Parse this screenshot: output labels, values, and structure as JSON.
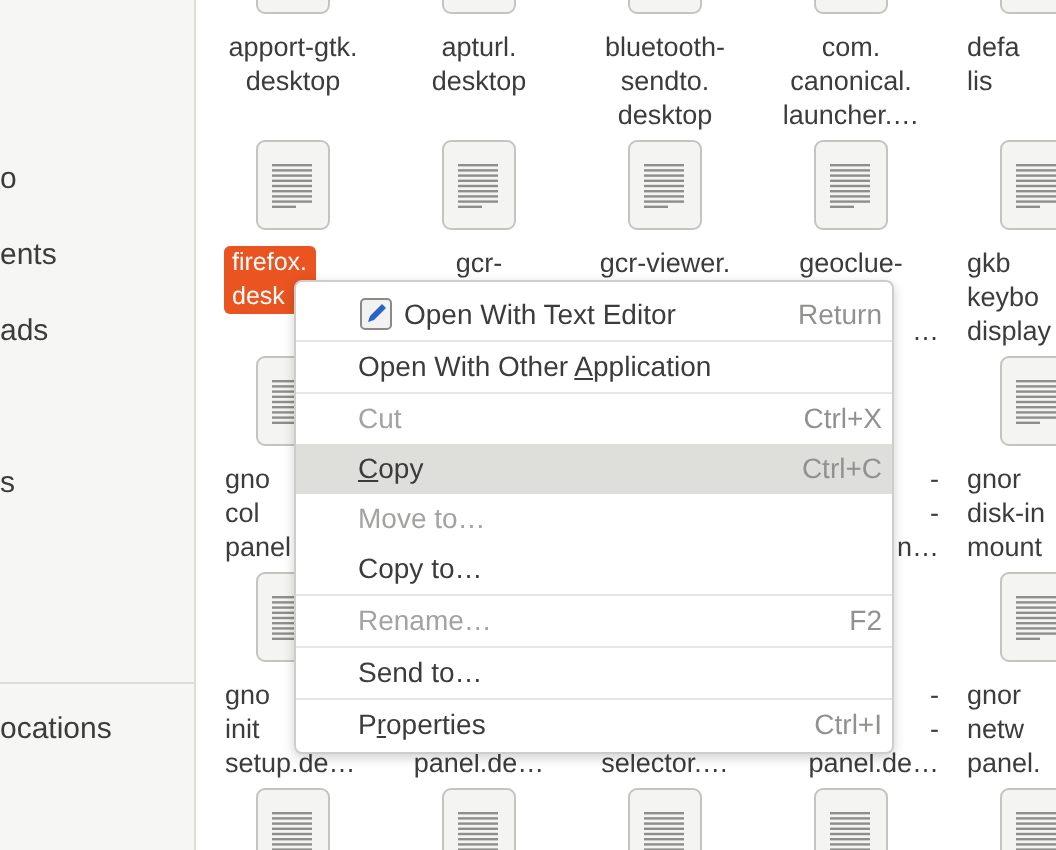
{
  "sidebar": {
    "items": [
      {
        "label": "o"
      },
      {
        "label": "ents"
      },
      {
        "label": "ads"
      },
      {
        "label": "s"
      }
    ],
    "other_locations": "ocations"
  },
  "files": {
    "rows": [
      {
        "items": [
          {
            "kind": "file",
            "lines": [
              "apport-gtk.",
              "desktop"
            ],
            "selected": false
          },
          {
            "kind": "file",
            "lines": [
              "apturl.",
              "desktop"
            ],
            "selected": false
          },
          {
            "kind": "file",
            "lines": [
              "bluetooth-",
              "sendto.",
              "desktop"
            ],
            "selected": false
          },
          {
            "kind": "file",
            "lines": [
              "com.",
              "canonical.",
              "launcher.…"
            ],
            "selected": false
          },
          {
            "kind": "file",
            "lines": [
              "defa",
              "lis"
            ],
            "selected": false
          }
        ]
      },
      {
        "items": [
          {
            "kind": "file",
            "lines": [
              "firefox.",
              "desk"
            ],
            "selected": true
          },
          {
            "kind": "file",
            "lines": [
              "gcr-"
            ],
            "selected": false
          },
          {
            "kind": "file",
            "lines": [
              "gcr-viewer."
            ],
            "selected": false
          },
          {
            "kind": "file",
            "lines": [
              "geoclue-",
              "…"
            ],
            "selected": false
          },
          {
            "kind": "file",
            "lines": [
              "gkb",
              "keybo",
              "display"
            ],
            "selected": false
          }
        ]
      },
      {
        "items": [
          {
            "kind": "file",
            "lines": [
              "gno",
              "col",
              "panel"
            ],
            "selected": false
          },
          {
            "kind": "file",
            "lines": [
              "-",
              "-",
              "n…"
            ],
            "selected": false
          },
          {
            "kind": "file",
            "lines": [
              "gnor",
              "disk-in",
              "mount"
            ],
            "selected": false
          }
        ]
      },
      {
        "items": [
          {
            "kind": "file",
            "lines": [
              "gno",
              "init",
              "setup.de…"
            ],
            "selected": false
          },
          {
            "kind": "file",
            "lines": [
              "panel.de…"
            ],
            "selected": false
          },
          {
            "kind": "file",
            "lines": [
              "selector.…"
            ],
            "selected": false
          },
          {
            "kind": "file",
            "lines": [
              "-",
              "-",
              "panel.de…"
            ],
            "selected": false
          },
          {
            "kind": "file",
            "lines": [
              "gnor",
              "netw",
              "panel."
            ],
            "selected": false
          }
        ]
      },
      {
        "items": [
          {
            "kind": "file"
          },
          {
            "kind": "file"
          },
          {
            "kind": "file"
          },
          {
            "kind": "file"
          },
          {
            "kind": "file"
          }
        ]
      }
    ]
  },
  "context_menu": {
    "items": [
      {
        "kind": "with-icon",
        "label": "Open With Text Editor",
        "shortcut": "Return",
        "disabled": false,
        "selected": false
      },
      {
        "kind": "separator"
      },
      {
        "kind": "command",
        "label": [
          {
            "text": "Open With Other ",
            "underline": false
          },
          {
            "text": "A",
            "underline": true
          },
          {
            "text": "pplication",
            "underline": false
          }
        ],
        "disabled": false,
        "selected": false
      },
      {
        "kind": "separator"
      },
      {
        "kind": "command",
        "label": "Cut",
        "shortcut": "Ctrl+X",
        "disabled": true,
        "selected": false
      },
      {
        "kind": "command",
        "label": [
          {
            "text": "C",
            "underline": true
          },
          {
            "text": "opy",
            "underline": false
          }
        ],
        "shortcut": "Ctrl+C",
        "disabled": false,
        "selected": true
      },
      {
        "kind": "command",
        "label": "Move to…",
        "disabled": true,
        "selected": false
      },
      {
        "kind": "command",
        "label": "Copy to…",
        "disabled": false,
        "selected": false
      },
      {
        "kind": "separator"
      },
      {
        "kind": "command",
        "label": "Rename…",
        "shortcut": "F2",
        "disabled": true,
        "selected": false
      },
      {
        "kind": "separator"
      },
      {
        "kind": "command",
        "label": "Send to…",
        "disabled": false,
        "selected": false
      },
      {
        "kind": "separator"
      },
      {
        "kind": "command",
        "label": [
          {
            "text": "P",
            "underline": false
          },
          {
            "text": "r",
            "underline": true
          },
          {
            "text": "operties",
            "underline": false
          }
        ],
        "shortcut": "Ctrl+I",
        "disabled": false,
        "selected": false
      }
    ]
  }
}
